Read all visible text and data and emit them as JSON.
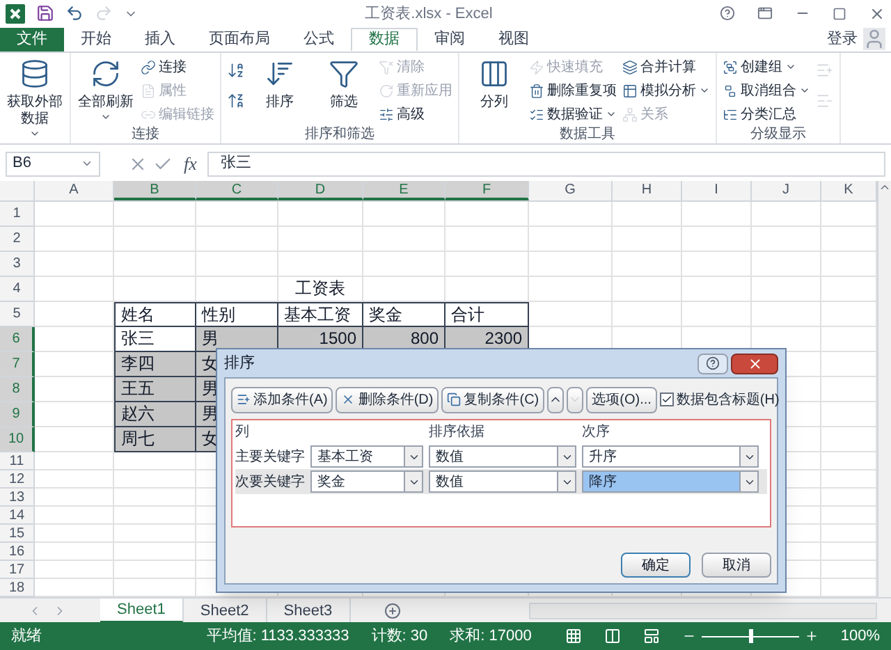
{
  "window": {
    "title": "工资表.xlsx - Excel",
    "sign_in": "登录"
  },
  "tabs": [
    {
      "label": "文件",
      "kind": "file",
      "selected": false
    },
    {
      "label": "开始",
      "kind": "tab",
      "selected": false
    },
    {
      "label": "插入",
      "kind": "tab",
      "selected": false
    },
    {
      "label": "页面布局",
      "kind": "tab",
      "selected": false
    },
    {
      "label": "公式",
      "kind": "tab",
      "selected": false
    },
    {
      "label": "数据",
      "kind": "tab",
      "selected": true
    },
    {
      "label": "审阅",
      "kind": "tab",
      "selected": false
    },
    {
      "label": "视图",
      "kind": "tab",
      "selected": false
    }
  ],
  "ribbon": {
    "groups": [
      {
        "columns": [
          [
            {
              "kind": "large",
              "label": "获取外部数据",
              "disabled": false,
              "dropdown": true
            }
          ]
        ]
      },
      {
        "label": "连接",
        "columns": [
          [
            {
              "kind": "large",
              "label": "全部刷新",
              "disabled": false,
              "dropdown": true
            }
          ],
          [
            {
              "kind": "small",
              "label": "连接",
              "disabled": false,
              "dropdown": false
            },
            {
              "kind": "small",
              "label": "属性",
              "disabled": true,
              "dropdown": false
            },
            {
              "kind": "small",
              "label": "编辑链接",
              "disabled": true,
              "dropdown": false
            }
          ]
        ]
      },
      {
        "label": "排序和筛选",
        "columns": [
          [
            {
              "kind": "icon",
              "disabled": false
            },
            {
              "kind": "icon",
              "disabled": false
            }
          ],
          [
            {
              "kind": "large",
              "label": "排序",
              "disabled": false,
              "dropdown": false
            }
          ],
          [
            {
              "kind": "large",
              "label": "筛选",
              "disabled": false,
              "dropdown": false
            }
          ],
          [
            {
              "kind": "small",
              "label": "清除",
              "disabled": true,
              "dropdown": false
            },
            {
              "kind": "small",
              "label": "重新应用",
              "disabled": true,
              "dropdown": false
            },
            {
              "kind": "small",
              "label": "高级",
              "disabled": false,
              "dropdown": false
            }
          ]
        ]
      },
      {
        "label": "数据工具",
        "columns": [
          [
            {
              "kind": "large",
              "label": "分列",
              "disabled": false,
              "dropdown": false
            }
          ],
          [
            {
              "kind": "small",
              "label": "快速填充",
              "disabled": true,
              "dropdown": false
            },
            {
              "kind": "small",
              "label": "删除重复项",
              "disabled": false,
              "dropdown": false
            },
            {
              "kind": "small",
              "label": "数据验证",
              "disabled": false,
              "dropdown": true
            }
          ],
          [
            {
              "kind": "small",
              "label": "合并计算",
              "disabled": false,
              "dropdown": false
            },
            {
              "kind": "small",
              "label": "模拟分析",
              "disabled": false,
              "dropdown": true
            },
            {
              "kind": "small",
              "label": "关系",
              "disabled": true,
              "dropdown": false
            }
          ]
        ]
      },
      {
        "label": "分级显示",
        "columns": [
          [
            {
              "kind": "small",
              "label": "创建组",
              "disabled": false,
              "dropdown": true
            },
            {
              "kind": "small",
              "label": "取消组合",
              "disabled": false,
              "dropdown": true
            },
            {
              "kind": "small",
              "label": "分类汇总",
              "disabled": false,
              "dropdown": false
            }
          ],
          [
            {
              "kind": "icon",
              "disabled": true
            },
            {
              "kind": "icon",
              "disabled": true
            }
          ]
        ]
      }
    ]
  },
  "formula_bar": {
    "name_box": "B6",
    "fx": "fx",
    "value": "张三"
  },
  "sheet": {
    "columns": [
      {
        "label": "A",
        "selected": false
      },
      {
        "label": "B",
        "selected": true
      },
      {
        "label": "C",
        "selected": true
      },
      {
        "label": "D",
        "selected": true
      },
      {
        "label": "E",
        "selected": true
      },
      {
        "label": "F",
        "selected": true
      },
      {
        "label": "G",
        "selected": false
      },
      {
        "label": "H",
        "selected": false
      },
      {
        "label": "I",
        "selected": false
      },
      {
        "label": "J",
        "selected": false
      },
      {
        "label": "K",
        "selected": false
      }
    ],
    "rows": [
      {
        "number": "1",
        "selected": false
      },
      {
        "number": "2",
        "selected": false
      },
      {
        "number": "3",
        "selected": false
      },
      {
        "number": "4",
        "selected": false
      },
      {
        "number": "5",
        "selected": false
      },
      {
        "number": "6",
        "selected": true
      },
      {
        "number": "7",
        "selected": true
      },
      {
        "number": "8",
        "selected": true
      },
      {
        "number": "9",
        "selected": true
      },
      {
        "number": "10",
        "selected": true
      },
      {
        "number": "11",
        "selected": false
      },
      {
        "number": "12",
        "selected": false
      },
      {
        "number": "13",
        "selected": false
      },
      {
        "number": "14",
        "selected": false
      },
      {
        "number": "15",
        "selected": false
      },
      {
        "number": "16",
        "selected": false
      },
      {
        "number": "17",
        "selected": false
      },
      {
        "number": "18",
        "selected": false
      }
    ],
    "table": {
      "title": "工资表",
      "headers": [
        "姓名",
        "性别",
        "基本工资",
        "奖金",
        "合计"
      ],
      "rows": [
        [
          {
            "text": "张三",
            "kind": "text",
            "active": true
          },
          {
            "text": "男",
            "kind": "text",
            "active": false
          },
          {
            "text": "1500",
            "kind": "number",
            "active": false
          },
          {
            "text": "800",
            "kind": "number",
            "active": false
          },
          {
            "text": "2300",
            "kind": "number",
            "active": false
          }
        ],
        [
          {
            "text": "李四",
            "kind": "text",
            "active": false
          },
          {
            "text": "女",
            "kind": "text",
            "active": false
          }
        ],
        [
          {
            "text": "王五",
            "kind": "text",
            "active": false
          },
          {
            "text": "男",
            "kind": "text",
            "active": false
          }
        ],
        [
          {
            "text": "赵六",
            "kind": "text",
            "active": false
          },
          {
            "text": "男",
            "kind": "text",
            "active": false
          }
        ],
        [
          {
            "text": "周七",
            "kind": "text",
            "active": false
          },
          {
            "text": "女",
            "kind": "text",
            "active": false
          }
        ]
      ]
    }
  },
  "sheet_tabs": [
    {
      "label": "Sheet1",
      "selected": true
    },
    {
      "label": "Sheet2",
      "selected": false
    },
    {
      "label": "Sheet3",
      "selected": false
    }
  ],
  "status_bar": {
    "status": "就绪",
    "average": "平均值: 1133.333333",
    "count": "计数: 30",
    "sum": "求和: 17000",
    "zoom": {
      "level": 0.5,
      "reading": "100%"
    }
  },
  "dialog": {
    "title": "排序",
    "toolbar": [
      {
        "kind": "add",
        "label": "添加条件(A)",
        "disabled": false
      },
      {
        "kind": "delete",
        "label": "删除条件(D)",
        "disabled": false
      },
      {
        "kind": "copy",
        "label": "复制条件(C)",
        "disabled": false
      },
      {
        "kind": "up",
        "disabled": false
      },
      {
        "kind": "down",
        "disabled": true
      },
      {
        "kind": "options",
        "label": "选项(O)...",
        "disabled": false
      }
    ],
    "has_headers": {
      "label": "数据包含标题(H)",
      "checked": true
    },
    "headers": [
      "列",
      "排序依据",
      "次序"
    ],
    "rows": [
      {
        "label": "主要关键字",
        "column": "基本工资",
        "sort_on": "数值",
        "order": "升序",
        "selected": false
      },
      {
        "label": "次要关键字",
        "column": "奖金",
        "sort_on": "数值",
        "order": "降序",
        "selected": true
      }
    ],
    "buttons": [
      {
        "label": "确定",
        "default": true
      },
      {
        "label": "取消",
        "default": false
      }
    ]
  }
}
